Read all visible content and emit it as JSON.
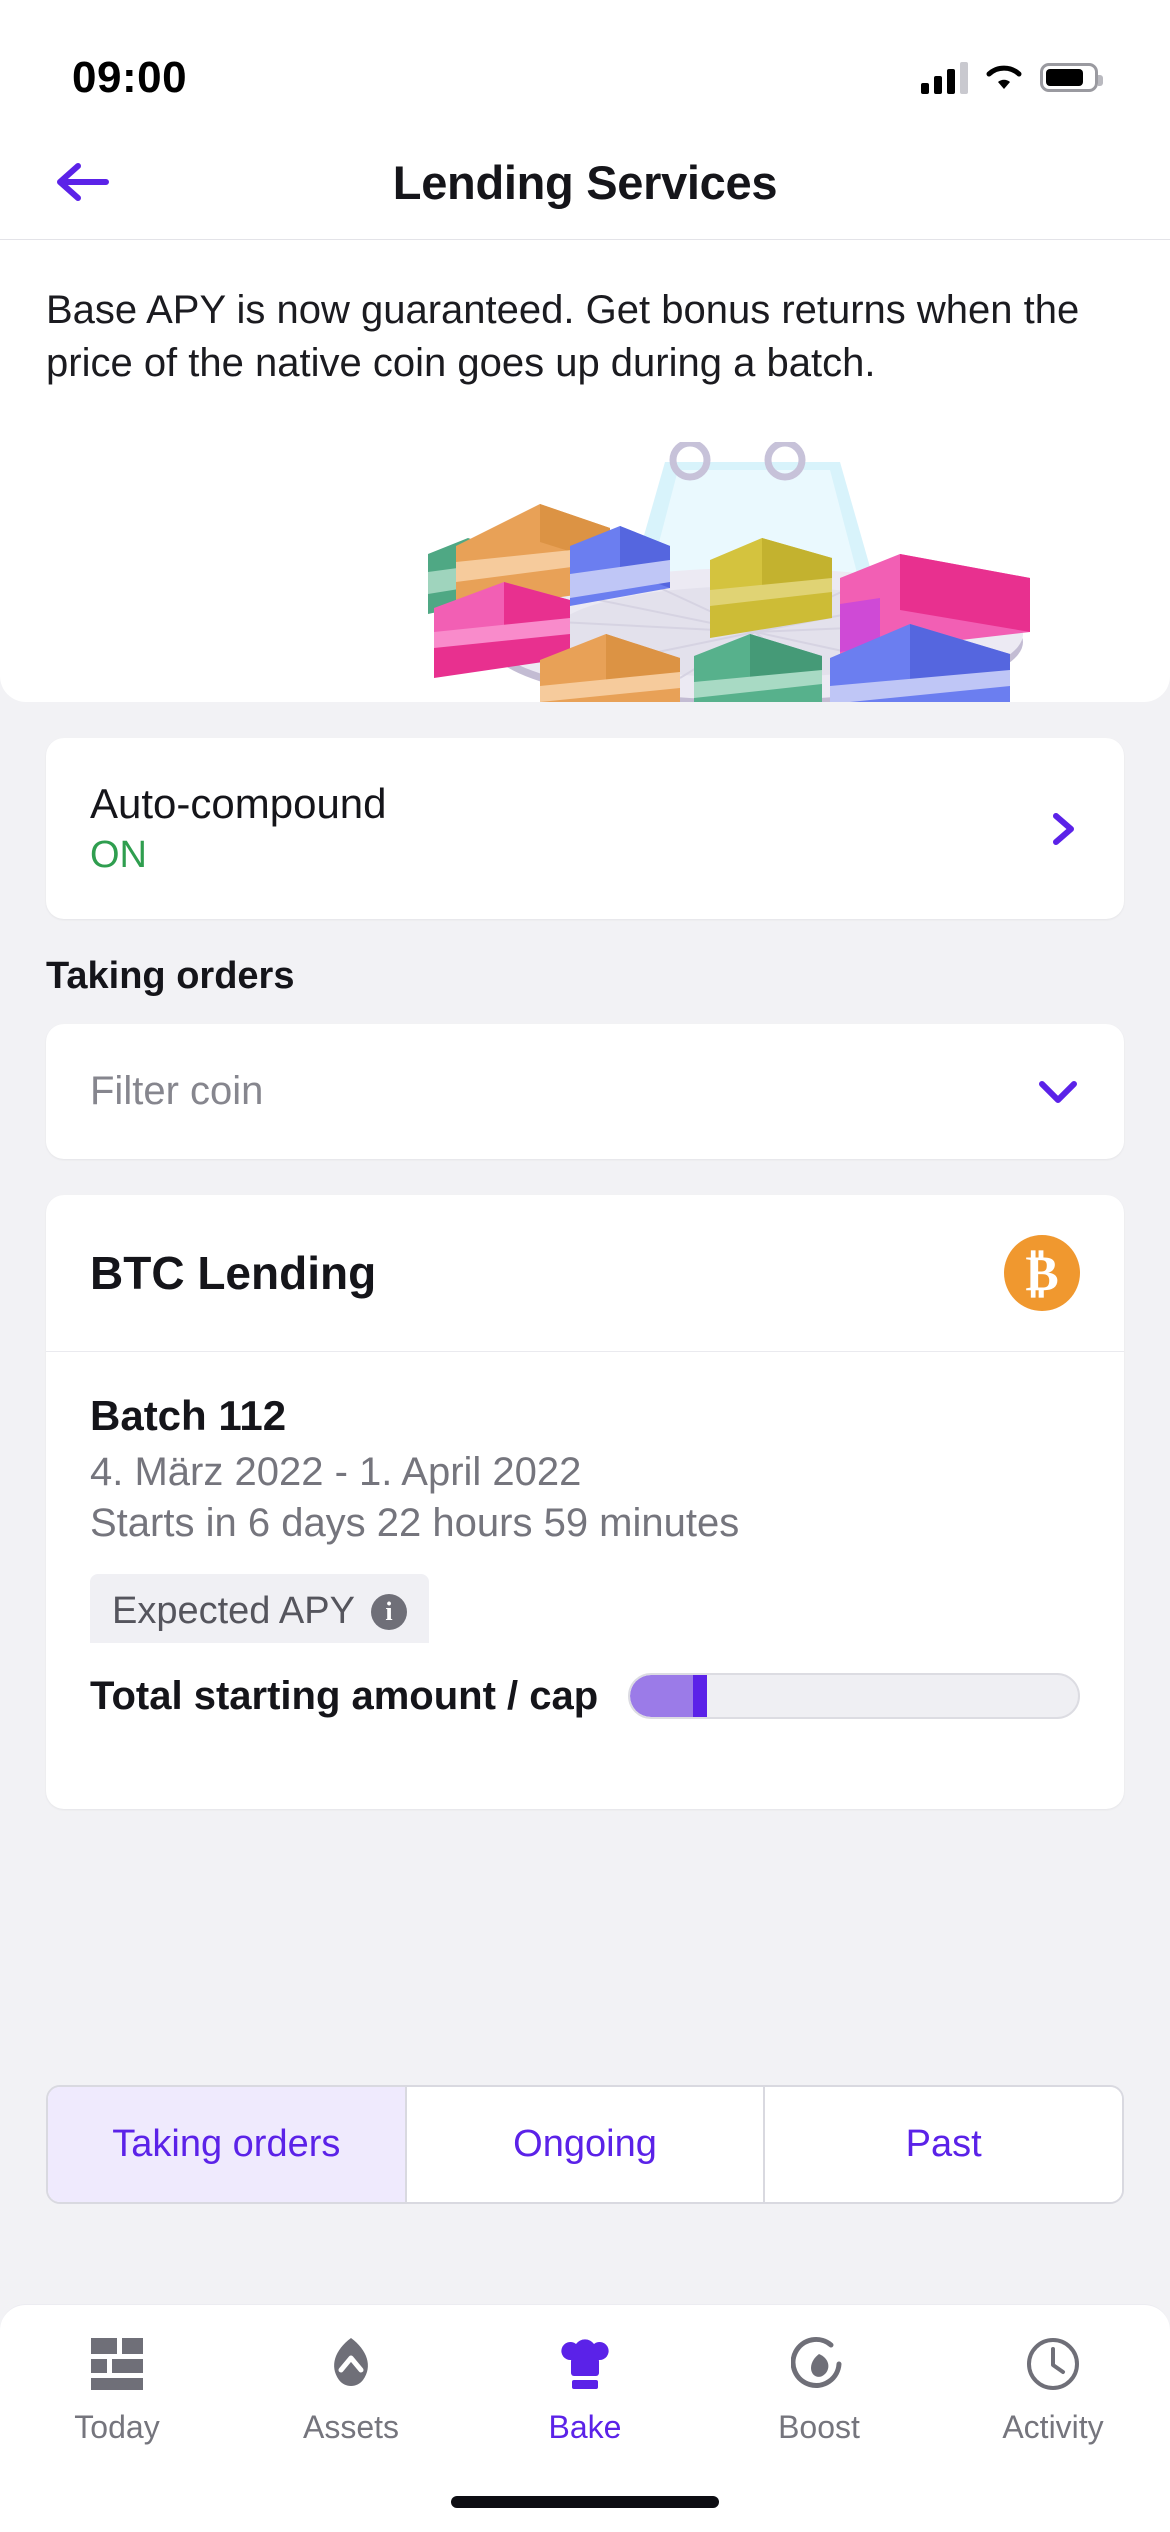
{
  "status_bar": {
    "time": "09:00",
    "signal_icon": "cellular-signal-icon",
    "wifi_icon": "wifi-icon",
    "battery_icon": "battery-icon"
  },
  "header": {
    "back_icon": "arrow-left-icon",
    "title": "Lending Services"
  },
  "hero": {
    "description": "Base APY is now guaranteed. Get bonus returns when the price of the native coin goes up during a batch.",
    "illustration_name": "lending-cakes-illustration"
  },
  "auto_compound": {
    "label": "Auto-compound",
    "state": "ON",
    "state_color": "#2f9e4f",
    "chevron_icon": "chevron-right-icon"
  },
  "taking_orders": {
    "section_heading": "Taking orders",
    "filter_placeholder": "Filter coin",
    "filter_value": "",
    "filter_chevron_icon": "chevron-down-icon"
  },
  "coin_card": {
    "name": "BTC Lending",
    "coin_symbol": "₿",
    "coin_color": "#f0982f",
    "batch_title": "Batch 112",
    "batch_dates": "4. März 2022 - 1. April 2022",
    "starts_in": "Starts in  6 days 22 hours 59 minutes",
    "expected_apy_label": "Expected APY",
    "info_icon": "info-icon",
    "total_label": "Total starting amount / cap",
    "progress_percent": 14
  },
  "segmented_tabs": {
    "items": [
      {
        "label": "Taking orders",
        "active": true
      },
      {
        "label": "Ongoing",
        "active": false
      },
      {
        "label": "Past",
        "active": false
      }
    ],
    "accent_color": "#5b22e8",
    "active_bg": "#efeafd"
  },
  "bottom_nav": {
    "items": [
      {
        "label": "Today",
        "icon": "grid-icon",
        "active": false
      },
      {
        "label": "Assets",
        "icon": "assets-arrow-icon",
        "active": false
      },
      {
        "label": "Bake",
        "icon": "chef-hat-icon",
        "active": true
      },
      {
        "label": "Boost",
        "icon": "boost-circle-icon",
        "active": false
      },
      {
        "label": "Activity",
        "icon": "clock-icon",
        "active": false
      }
    ]
  },
  "theme": {
    "accent": "#5b22e8",
    "background": "#f2f2f5",
    "card": "#ffffff"
  }
}
